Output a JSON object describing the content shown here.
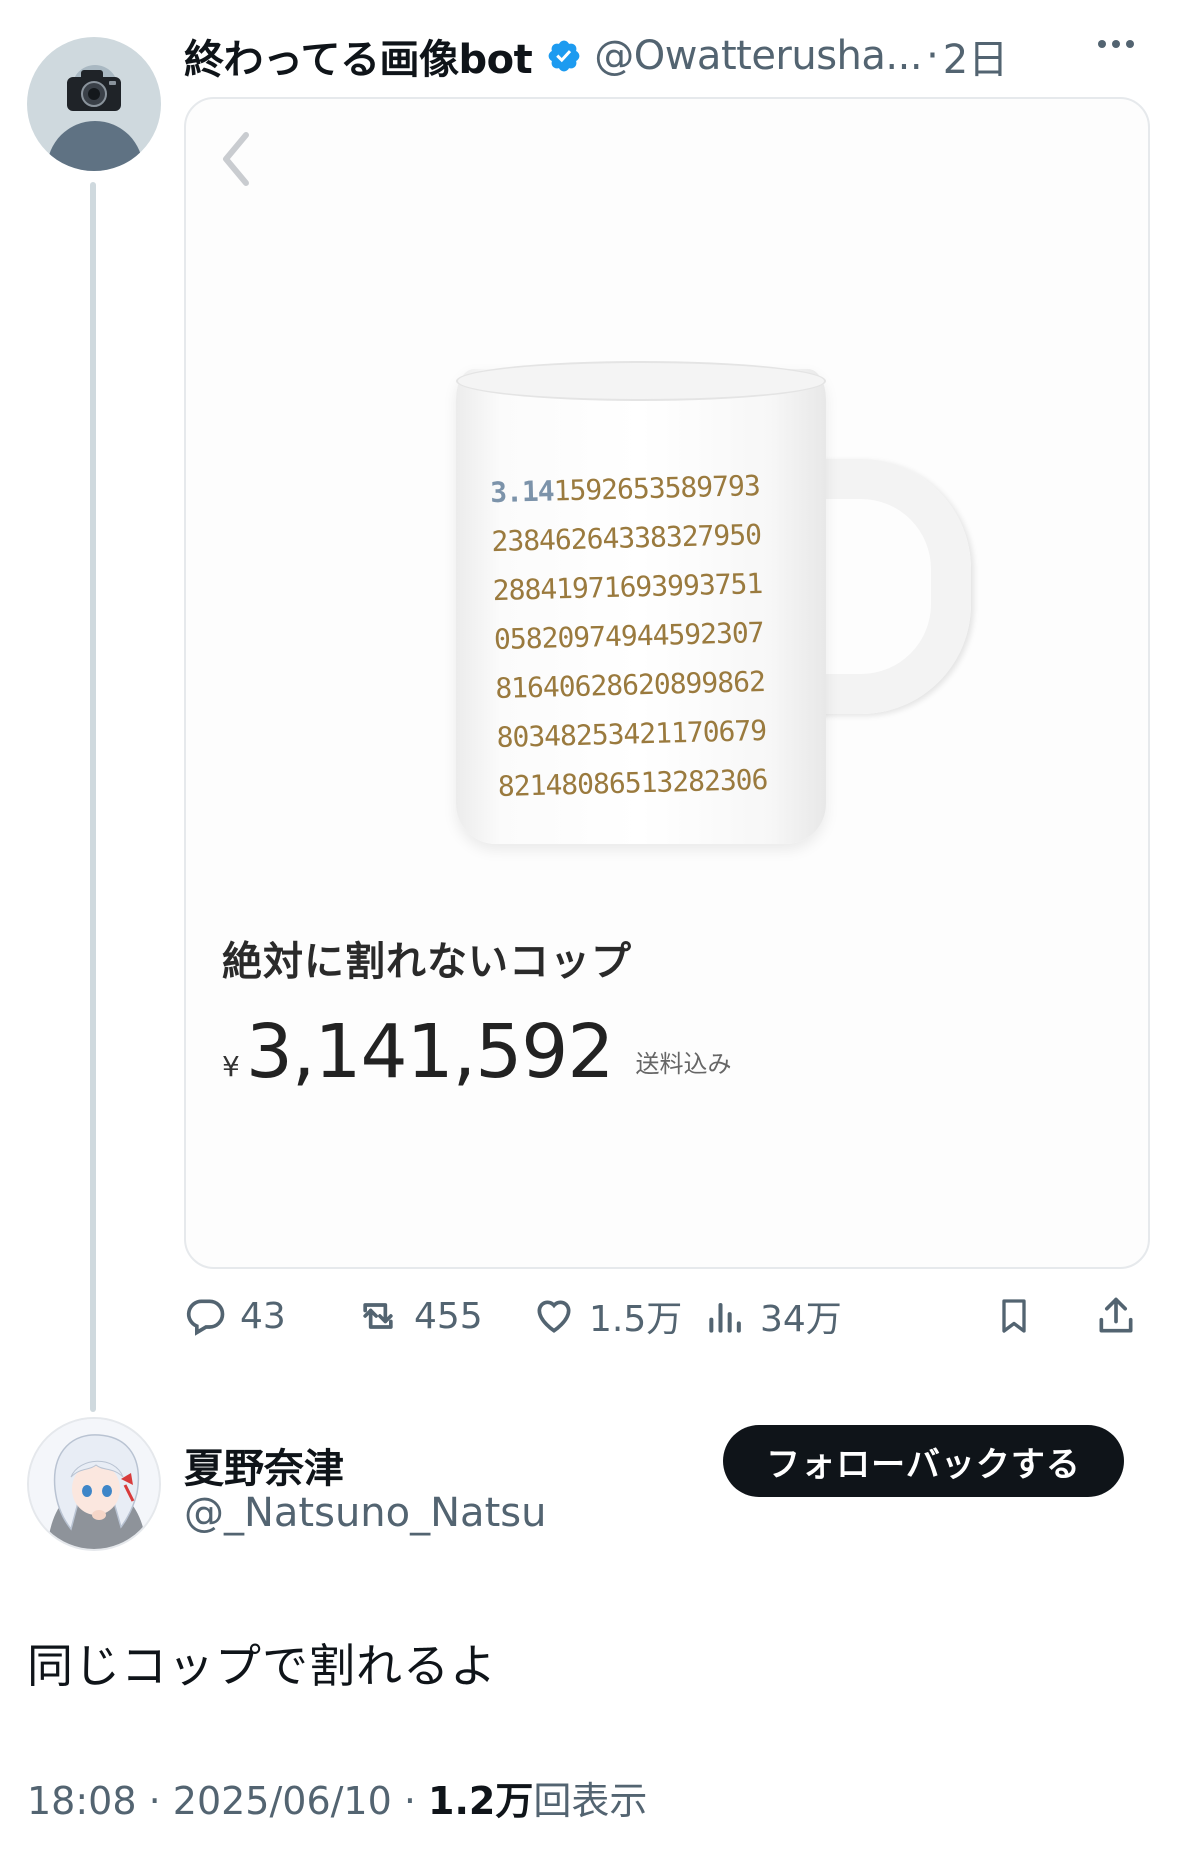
{
  "tweet": {
    "author": {
      "display_name": "終わってる画像bot",
      "handle": "@Owatterusha...",
      "verified": true,
      "avatar_icon": "camera-icon"
    },
    "separator": "·",
    "time": "2日",
    "card": {
      "mug_digits": [
        {
          "lead": "3.14",
          "rest": "159265358979 3"
        },
        {
          "lead": "",
          "rest": "2384626433832795 0"
        },
        {
          "lead": "",
          "rest": "2884197169399375 1"
        },
        {
          "lead": "",
          "rest": "0582097494459230 7"
        },
        {
          "lead": "",
          "rest": "8164062862089986 2"
        },
        {
          "lead": "",
          "rest": "8034825342117067 9"
        },
        {
          "lead": "",
          "rest": "8214808651328230 6"
        }
      ],
      "product_title": "絶対に割れないコップ",
      "currency_symbol": "¥",
      "price": "3,141,592",
      "shipping_note": "送料込み"
    },
    "actions": {
      "replies": "43",
      "retweets": "455",
      "likes": "1.5万",
      "views": "34万"
    }
  },
  "reply": {
    "author": {
      "display_name": "夏野奈津",
      "handle": "@_Natsuno_Natsu"
    },
    "follow_button_label": "フォローバックする",
    "text": "同じコップで割れるよ",
    "meta": {
      "time": "18:08",
      "sep": " · ",
      "date": "2025/06/10",
      "views_count": "1.2万",
      "views_label": "回表示"
    }
  },
  "colors": {
    "text_primary": "#0f1419",
    "text_secondary": "#536471",
    "verified_blue": "#1d9bf0",
    "thread_line": "#cfd9de"
  }
}
